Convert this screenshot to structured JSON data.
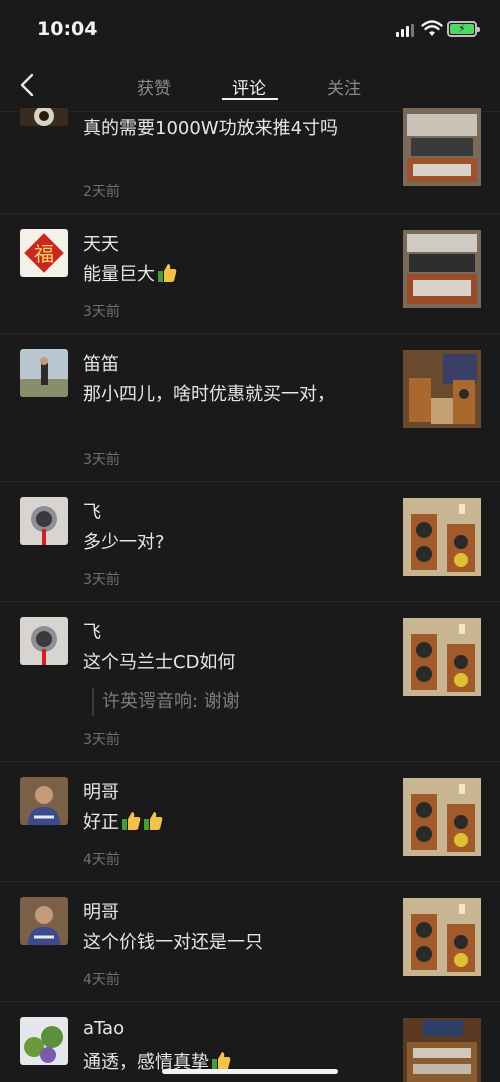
{
  "status": {
    "time": "10:04"
  },
  "nav": {
    "tabs": [
      "获赞",
      "评论",
      "关注"
    ],
    "active_tab": "评论"
  },
  "comments": [
    {
      "name": "",
      "text": "真的需要1000W功放来推4寸吗",
      "time": "2天前",
      "reply": ""
    },
    {
      "name": "天天",
      "text": "能量巨大",
      "time": "3天前",
      "reply": ""
    },
    {
      "name": "笛笛",
      "text": "那小四儿，啥时优惠就买一对，",
      "time": "3天前",
      "reply": ""
    },
    {
      "name": "飞",
      "text": "多少一对?",
      "time": "3天前",
      "reply": ""
    },
    {
      "name": "飞",
      "text": "这个马兰士CD如何",
      "time": "3天前",
      "reply": "许英谔音响: 谢谢"
    },
    {
      "name": "明哥",
      "text": "好正",
      "time": "4天前",
      "reply": ""
    },
    {
      "name": "明哥",
      "text": "这个价钱一对还是一只",
      "time": "4天前",
      "reply": ""
    },
    {
      "name": "aTao",
      "text": "通透，感情真挚",
      "time": "",
      "reply": ""
    }
  ],
  "colors": {
    "background": "#1a1a1a",
    "text": "#e6e6e6",
    "muted": "#6f6f6f",
    "battery": "#4cd964"
  }
}
